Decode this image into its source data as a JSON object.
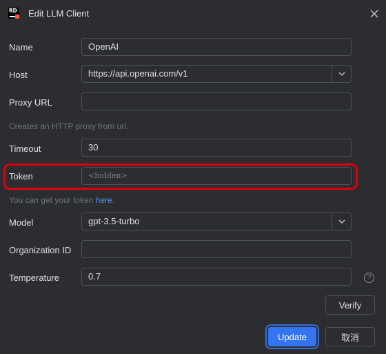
{
  "window": {
    "title": "Edit LLM Client",
    "logo_text": "RD",
    "close_icon": "close-icon"
  },
  "form": {
    "name": {
      "label": "Name",
      "value": "OpenAI"
    },
    "host": {
      "label": "Host",
      "value": "https://api.openai.com/v1",
      "dropdown_icon": "chevron-down-icon"
    },
    "proxy_url": {
      "label": "Proxy URL",
      "value": "",
      "hint": "Creates an HTTP proxy from url."
    },
    "timeout": {
      "label": "Timeout",
      "value": "30"
    },
    "token": {
      "label": "Token",
      "placeholder": "<hidden>",
      "hint_prefix": "You can get your token ",
      "hint_link": "here",
      "hint_suffix": "."
    },
    "model": {
      "label": "Model",
      "value": "gpt-3.5-turbo",
      "dropdown_icon": "chevron-down-icon"
    },
    "organization_id": {
      "label": "Organization ID",
      "value": ""
    },
    "temperature": {
      "label": "Temperature",
      "value": "0.7",
      "help_icon": "question-circle-icon",
      "help_glyph": "?"
    }
  },
  "buttons": {
    "verify": "Verify",
    "update": "Update",
    "cancel": "取消"
  },
  "colors": {
    "background": "#2b2d30",
    "primary": "#3574f0",
    "link": "#548af7",
    "highlight": "#e0000b"
  }
}
